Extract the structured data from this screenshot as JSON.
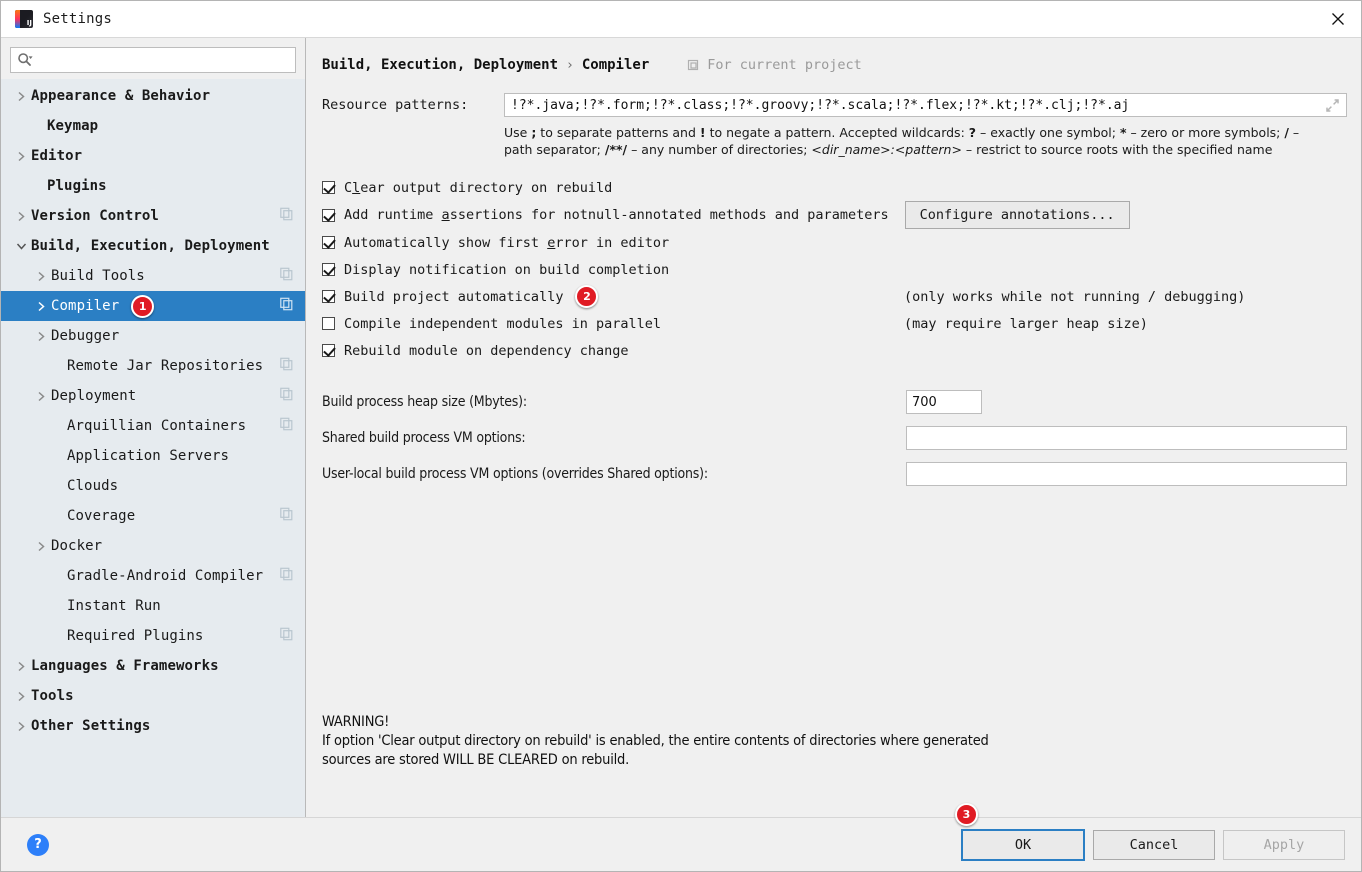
{
  "window": {
    "title": "Settings",
    "app_icon": "intellij-idea-icon",
    "close_icon": "close-icon"
  },
  "search": {
    "placeholder": "",
    "value": "",
    "icon": "search-icon"
  },
  "sidebar": {
    "items": [
      {
        "label": "Appearance & Behavior",
        "level": 0,
        "arrow": "collapsed",
        "bold": true,
        "copy": false,
        "selected": false
      },
      {
        "label": "Keymap",
        "level": 0,
        "arrow": "none",
        "bold": true,
        "copy": false,
        "selected": false
      },
      {
        "label": "Editor",
        "level": 0,
        "arrow": "collapsed",
        "bold": true,
        "copy": false,
        "selected": false
      },
      {
        "label": "Plugins",
        "level": 0,
        "arrow": "none",
        "bold": true,
        "copy": false,
        "selected": false
      },
      {
        "label": "Version Control",
        "level": 0,
        "arrow": "collapsed",
        "bold": true,
        "copy": true,
        "selected": false
      },
      {
        "label": "Build, Execution, Deployment",
        "level": 0,
        "arrow": "expanded",
        "bold": true,
        "copy": false,
        "selected": false
      },
      {
        "label": "Build Tools",
        "level": 1,
        "arrow": "collapsed",
        "bold": false,
        "copy": true,
        "selected": false
      },
      {
        "label": "Compiler",
        "level": 1,
        "arrow": "collapsed",
        "bold": false,
        "copy": true,
        "selected": true,
        "badge": "1"
      },
      {
        "label": "Debugger",
        "level": 1,
        "arrow": "collapsed",
        "bold": false,
        "copy": false,
        "selected": false
      },
      {
        "label": "Remote Jar Repositories",
        "level": 1,
        "arrow": "none",
        "bold": false,
        "copy": true,
        "selected": false
      },
      {
        "label": "Deployment",
        "level": 1,
        "arrow": "collapsed",
        "bold": false,
        "copy": true,
        "selected": false
      },
      {
        "label": "Arquillian Containers",
        "level": 1,
        "arrow": "none",
        "bold": false,
        "copy": true,
        "selected": false
      },
      {
        "label": "Application Servers",
        "level": 1,
        "arrow": "none",
        "bold": false,
        "copy": false,
        "selected": false
      },
      {
        "label": "Clouds",
        "level": 1,
        "arrow": "none",
        "bold": false,
        "copy": false,
        "selected": false
      },
      {
        "label": "Coverage",
        "level": 1,
        "arrow": "none",
        "bold": false,
        "copy": true,
        "selected": false
      },
      {
        "label": "Docker",
        "level": 1,
        "arrow": "collapsed",
        "bold": false,
        "copy": false,
        "selected": false
      },
      {
        "label": "Gradle-Android Compiler",
        "level": 1,
        "arrow": "none",
        "bold": false,
        "copy": true,
        "selected": false
      },
      {
        "label": "Instant Run",
        "level": 1,
        "arrow": "none",
        "bold": false,
        "copy": false,
        "selected": false
      },
      {
        "label": "Required Plugins",
        "level": 1,
        "arrow": "none",
        "bold": false,
        "copy": true,
        "selected": false
      },
      {
        "label": "Languages & Frameworks",
        "level": 0,
        "arrow": "collapsed",
        "bold": true,
        "copy": false,
        "selected": false
      },
      {
        "label": "Tools",
        "level": 0,
        "arrow": "collapsed",
        "bold": true,
        "copy": false,
        "selected": false
      },
      {
        "label": "Other Settings",
        "level": 0,
        "arrow": "collapsed",
        "bold": true,
        "copy": false,
        "selected": false
      }
    ]
  },
  "main": {
    "breadcrumb_root": "Build, Execution, Deployment",
    "breadcrumb_sep": "›",
    "breadcrumb_current": "Compiler",
    "scope_label": "For current project",
    "scope_icon": "project-scope-icon",
    "resource_patterns": {
      "label": "Resource patterns:",
      "value": "!?*.java;!?*.form;!?*.class;!?*.groovy;!?*.scala;!?*.flex;!?*.kt;!?*.clj;!?*.aj",
      "expand_icon": "expand-icon"
    },
    "hint_parts": {
      "p1": "Use ",
      "b1": ";",
      "p2": " to separate patterns and ",
      "b2": "!",
      "p3": " to negate a pattern. Accepted wildcards: ",
      "b3": "?",
      "p4": " – exactly one symbol; ",
      "b4": "*",
      "p5": " – zero or more symbols; ",
      "b5": "/",
      "p6": " – path separator; ",
      "b6": "/**/",
      "p7": " – any number of directories; ",
      "i1": "<dir_name>:<pattern>",
      "p8": " – restrict to source roots with the specified name"
    },
    "checkboxes": [
      {
        "pre": "C",
        "mnemonic": "l",
        "post": "ear output directory on rebuild",
        "checked": true,
        "note": ""
      },
      {
        "pre": "Add runtime ",
        "mnemonic": "a",
        "post": "ssertions for notnull-annotated methods and parameters",
        "checked": true,
        "note": ""
      },
      {
        "pre": "Automatically show first ",
        "mnemonic": "e",
        "post": "rror in editor",
        "checked": true,
        "note": ""
      },
      {
        "pre": "Display notification on build completion",
        "mnemonic": "",
        "post": "",
        "checked": true,
        "note": ""
      },
      {
        "pre": "Build project automatically",
        "mnemonic": "",
        "post": "",
        "checked": true,
        "note": "(only works while not running / debugging)",
        "badge": "2"
      },
      {
        "pre": "Compile independent modules in parallel",
        "mnemonic": "",
        "post": "",
        "checked": false,
        "note": "(may require larger heap size)"
      },
      {
        "pre": "Rebuild module on dependency change",
        "mnemonic": "",
        "post": "",
        "checked": true,
        "note": ""
      }
    ],
    "configure_annotations_button": "Configure annotations...",
    "fields": [
      {
        "label": "Build process heap size (Mbytes):",
        "value": "700",
        "size": "small"
      },
      {
        "label": "Shared build process VM options:",
        "value": "",
        "size": "wide"
      },
      {
        "label": "User-local build process VM options (overrides Shared options):",
        "value": "",
        "size": "wide"
      }
    ],
    "warning": "WARNING!\nIf option 'Clear output directory on rebuild' is enabled, the entire contents of directories where generated\nsources are stored WILL BE CLEARED on rebuild."
  },
  "footer": {
    "help_icon": "help-icon",
    "help_glyph": "?",
    "ok_label": "OK",
    "ok_badge": "3",
    "cancel_label": "Cancel",
    "apply_label": "Apply"
  },
  "colors": {
    "selection_blue": "#2b7fc4",
    "badge_red": "#e01b24",
    "help_blue": "#2d7ff9",
    "sidebar_bg": "#e6ebef",
    "panel_bg": "#f0f0f0"
  }
}
